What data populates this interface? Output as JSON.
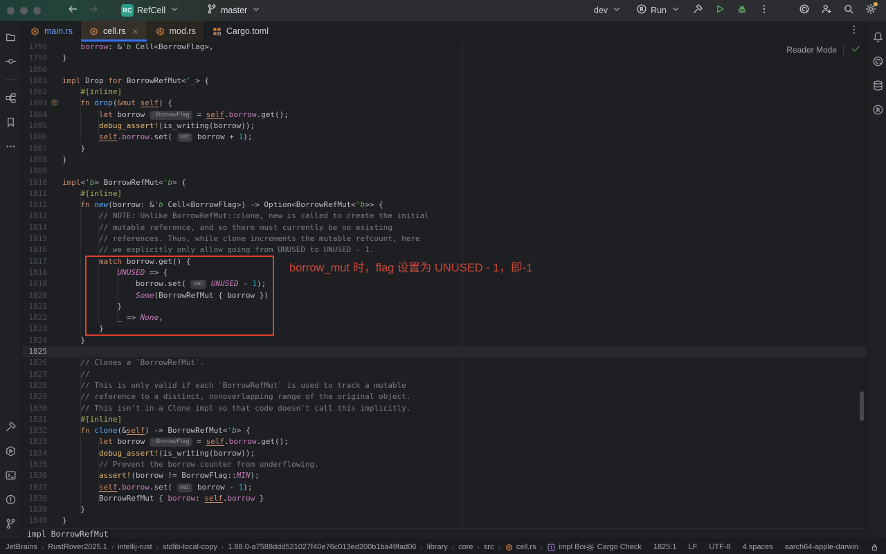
{
  "toolbar": {
    "project_badge": "RC",
    "project_name": "RefCell",
    "branch_name": "master",
    "run_target": "dev",
    "run_label": "Run",
    "left_icons": [
      "back-icon",
      "forward-icon"
    ],
    "right_icons": [
      "build-hammer-icon",
      "run-play-icon",
      "debug-bug-icon",
      "more-kebab-icon",
      "ai-assistant-icon",
      "add-user-icon",
      "search-everywhere-icon",
      "settings-gear-icon"
    ]
  },
  "tabs": [
    {
      "label": "main.rs",
      "icon": "rust-file",
      "active": false,
      "closable": false,
      "tint": false,
      "label_class": "lbl-main"
    },
    {
      "label": "cell.rs",
      "icon": "rust-file",
      "active": true,
      "closable": true,
      "tint": true,
      "label_class": ""
    },
    {
      "label": "mod.rs",
      "icon": "rust-file",
      "active": false,
      "closable": false,
      "tint": true,
      "label_class": ""
    },
    {
      "label": "Cargo.toml",
      "icon": "cargo",
      "active": false,
      "closable": false,
      "tint": false,
      "label_class": ""
    }
  ],
  "left_sidebar": {
    "top": [
      "folder",
      "commit",
      "divider",
      "structure",
      "bookmarks",
      "more"
    ],
    "bottom": [
      "build",
      "services",
      "terminal",
      "problems",
      "git-branch"
    ]
  },
  "right_sidebar": {
    "top": [
      "notifications",
      "ai-assistant",
      "database",
      "rust-tool"
    ]
  },
  "editor": {
    "reader_mode_label": "Reader Mode",
    "sticky_footer": "impl BorrowRefMut",
    "annotation": {
      "text": "borrow_mut 时，flag 设置为 UNUSED - 1，即-1",
      "from_line": 1817,
      "to_line": 1823,
      "box_color": "#E0402F",
      "text_color": "#C9483B"
    },
    "caret_line": 1825,
    "lines": [
      {
        "num": 1798,
        "t": [
          [
            "txt",
            "    "
          ],
          [
            "fld",
            "borrow"
          ],
          [
            "txt",
            ": &"
          ],
          [
            "lif",
            "'b "
          ],
          [
            "txt",
            "Cell<BorrowFlag>,"
          ]
        ]
      },
      {
        "num": 1799,
        "t": [
          [
            "txt",
            "}"
          ]
        ]
      },
      {
        "num": 1800,
        "t": []
      },
      {
        "num": 1801,
        "t": [
          [
            "kw",
            "impl"
          ],
          [
            "txt",
            " Drop "
          ],
          [
            "kw",
            "for"
          ],
          [
            "txt",
            " BorrowRefMut<"
          ],
          [
            "lif",
            "'_"
          ],
          [
            "txt",
            "> {"
          ]
        ]
      },
      {
        "num": 1802,
        "t": [
          [
            "txt",
            "    "
          ],
          [
            "attr",
            "#[inline]"
          ]
        ]
      },
      {
        "num": 1803,
        "icon": "override",
        "t": [
          [
            "txt",
            "    "
          ],
          [
            "kw",
            "fn "
          ],
          [
            "fn",
            "drop"
          ],
          [
            "txt",
            "("
          ],
          [
            "kw",
            "&mut "
          ],
          [
            "slf",
            "self"
          ],
          [
            "txt",
            ") {"
          ]
        ]
      },
      {
        "num": 1804,
        "t": [
          [
            "txt",
            "        "
          ],
          [
            "kw",
            "let"
          ],
          [
            "txt",
            " borrow "
          ],
          [
            "inl",
            ": BorrowFlag"
          ],
          [
            "txt",
            " = "
          ],
          [
            "slf",
            "self"
          ],
          [
            "txt",
            "."
          ],
          [
            "fld",
            "borrow"
          ],
          [
            "txt",
            ".get();"
          ]
        ]
      },
      {
        "num": 1805,
        "t": [
          [
            "txt",
            "        "
          ],
          [
            "mac",
            "debug_assert!"
          ],
          [
            "txt",
            "(is_writing(borrow));"
          ]
        ]
      },
      {
        "num": 1806,
        "t": [
          [
            "txt",
            "        "
          ],
          [
            "slf",
            "self"
          ],
          [
            "txt",
            "."
          ],
          [
            "fld",
            "borrow"
          ],
          [
            "txt",
            ".set( "
          ],
          [
            "inl",
            "val:"
          ],
          [
            "txt",
            " borrow + "
          ],
          [
            "num",
            "1"
          ],
          [
            "txt",
            ");"
          ]
        ]
      },
      {
        "num": 1807,
        "t": [
          [
            "txt",
            "    }"
          ]
        ]
      },
      {
        "num": 1808,
        "t": [
          [
            "txt",
            "}"
          ]
        ]
      },
      {
        "num": 1809,
        "t": []
      },
      {
        "num": 1810,
        "t": [
          [
            "kw",
            "impl"
          ],
          [
            "txt",
            "<"
          ],
          [
            "lif",
            "'b"
          ],
          [
            "txt",
            "> BorrowRefMut<"
          ],
          [
            "lif",
            "'b"
          ],
          [
            "txt",
            "> {"
          ]
        ]
      },
      {
        "num": 1811,
        "t": [
          [
            "txt",
            "    "
          ],
          [
            "attr",
            "#[inline]"
          ]
        ]
      },
      {
        "num": 1812,
        "t": [
          [
            "txt",
            "    "
          ],
          [
            "kw",
            "fn "
          ],
          [
            "fni",
            "new"
          ],
          [
            "txt",
            "(borrow: &"
          ],
          [
            "lif",
            "'b "
          ],
          [
            "txt",
            "Cell<BorrowFlag>) -> Option<BorrowRefMut<"
          ],
          [
            "lif",
            "'b"
          ],
          [
            "txt",
            ">> {"
          ]
        ]
      },
      {
        "num": 1813,
        "t": [
          [
            "txt",
            "        "
          ],
          [
            "cm",
            "// NOTE: Unlike BorrowRefMut::clone, new is called to create the initial"
          ]
        ]
      },
      {
        "num": 1814,
        "t": [
          [
            "txt",
            "        "
          ],
          [
            "cm",
            "// mutable reference, and so there must currently be no existing"
          ]
        ]
      },
      {
        "num": 1815,
        "t": [
          [
            "txt",
            "        "
          ],
          [
            "cm",
            "// references. Thus, while clone increments the mutable refcount, here"
          ]
        ]
      },
      {
        "num": 1816,
        "t": [
          [
            "txt",
            "        "
          ],
          [
            "cm",
            "// we explicitly only allow going from UNUSED to UNUSED - 1."
          ]
        ]
      },
      {
        "num": 1817,
        "t": [
          [
            "txt",
            "        "
          ],
          [
            "kw",
            "match"
          ],
          [
            "txt",
            " borrow.get() {"
          ]
        ]
      },
      {
        "num": 1818,
        "t": [
          [
            "txt",
            "            "
          ],
          [
            "con",
            "UNUSED"
          ],
          [
            "txt",
            " => {"
          ]
        ]
      },
      {
        "num": 1819,
        "t": [
          [
            "txt",
            "                borrow.set( "
          ],
          [
            "inl",
            "val:"
          ],
          [
            "txt",
            " "
          ],
          [
            "con",
            "UNUSED"
          ],
          [
            "txt",
            " - "
          ],
          [
            "num",
            "1"
          ],
          [
            "txt",
            ");"
          ]
        ]
      },
      {
        "num": 1820,
        "t": [
          [
            "txt",
            "                "
          ],
          [
            "con",
            "Some"
          ],
          [
            "txt",
            "(BorrowRefMut { borrow })"
          ]
        ]
      },
      {
        "num": 1821,
        "t": [
          [
            "txt",
            "            }"
          ]
        ]
      },
      {
        "num": 1822,
        "t": [
          [
            "txt",
            "            _ => "
          ],
          [
            "con",
            "None"
          ],
          [
            "txt",
            ","
          ]
        ]
      },
      {
        "num": 1823,
        "t": [
          [
            "txt",
            "        }"
          ]
        ]
      },
      {
        "num": 1824,
        "t": [
          [
            "txt",
            "    }"
          ]
        ]
      },
      {
        "num": 1825,
        "caret": true,
        "t": []
      },
      {
        "num": 1826,
        "t": [
          [
            "txt",
            "    "
          ],
          [
            "cm",
            "// Clones a `BorrowRefMut`."
          ]
        ]
      },
      {
        "num": 1827,
        "t": [
          [
            "txt",
            "    "
          ],
          [
            "cm",
            "//"
          ]
        ]
      },
      {
        "num": 1828,
        "t": [
          [
            "txt",
            "    "
          ],
          [
            "cm",
            "// This is only valid if each `BorrowRefMut` is used to track a mutable"
          ]
        ]
      },
      {
        "num": 1829,
        "t": [
          [
            "txt",
            "    "
          ],
          [
            "cm",
            "// reference to a distinct, nonoverlapping range of the original object."
          ]
        ]
      },
      {
        "num": 1830,
        "t": [
          [
            "txt",
            "    "
          ],
          [
            "cm",
            "// This isn't in a Clone impl so that code doesn't call this implicitly."
          ]
        ]
      },
      {
        "num": 1831,
        "t": [
          [
            "txt",
            "    "
          ],
          [
            "attr",
            "#[inline]"
          ]
        ]
      },
      {
        "num": 1832,
        "t": [
          [
            "txt",
            "    "
          ],
          [
            "kw",
            "fn "
          ],
          [
            "fn",
            "clone"
          ],
          [
            "txt",
            "(&"
          ],
          [
            "slf",
            "self"
          ],
          [
            "txt",
            ") -> BorrowRefMut<"
          ],
          [
            "lif",
            "'b"
          ],
          [
            "txt",
            "> {"
          ]
        ]
      },
      {
        "num": 1833,
        "t": [
          [
            "txt",
            "        "
          ],
          [
            "kw",
            "let"
          ],
          [
            "txt",
            " borrow "
          ],
          [
            "inl",
            ": BorrowFlag"
          ],
          [
            "txt",
            " = "
          ],
          [
            "slf",
            "self"
          ],
          [
            "txt",
            "."
          ],
          [
            "fld",
            "borrow"
          ],
          [
            "txt",
            ".get();"
          ]
        ]
      },
      {
        "num": 1834,
        "t": [
          [
            "txt",
            "        "
          ],
          [
            "mac",
            "debug_assert!"
          ],
          [
            "txt",
            "(is_writing(borrow));"
          ]
        ]
      },
      {
        "num": 1835,
        "t": [
          [
            "txt",
            "        "
          ],
          [
            "cm",
            "// Prevent the borrow counter from underflowing."
          ]
        ]
      },
      {
        "num": 1836,
        "t": [
          [
            "txt",
            "        "
          ],
          [
            "mac",
            "assert!"
          ],
          [
            "txt",
            "(borrow != BorrowFlag::"
          ],
          [
            "con",
            "MIN"
          ],
          [
            "txt",
            ");"
          ]
        ]
      },
      {
        "num": 1837,
        "t": [
          [
            "txt",
            "        "
          ],
          [
            "slf",
            "self"
          ],
          [
            "txt",
            "."
          ],
          [
            "fld",
            "borrow"
          ],
          [
            "txt",
            ".set( "
          ],
          [
            "inl",
            "val:"
          ],
          [
            "txt",
            " borrow - "
          ],
          [
            "num",
            "1"
          ],
          [
            "txt",
            ");"
          ]
        ]
      },
      {
        "num": 1838,
        "t": [
          [
            "txt",
            "        BorrowRefMut { "
          ],
          [
            "fld",
            "borrow"
          ],
          [
            "txt",
            ": "
          ],
          [
            "slf",
            "self"
          ],
          [
            "txt",
            "."
          ],
          [
            "fld",
            "borrow"
          ],
          [
            "txt",
            " }"
          ]
        ]
      },
      {
        "num": 1839,
        "t": [
          [
            "txt",
            "    }"
          ]
        ]
      },
      {
        "num": 1840,
        "t": [
          [
            "txt",
            "}"
          ]
        ]
      }
    ]
  },
  "statusbar": {
    "breadcrumbs": [
      {
        "label": "JetBrains"
      },
      {
        "label": "RustRover2025.1"
      },
      {
        "label": "intellij-rust"
      },
      {
        "label": "stdlib-local-copy"
      },
      {
        "label": "1.88.0-a7588ddd521027f40e76c013ed200b1ba49fad06"
      },
      {
        "label": "library"
      },
      {
        "label": "core"
      },
      {
        "label": "src"
      },
      {
        "label": "cell.rs",
        "icon": "rust-file"
      },
      {
        "label": "impl BorrowRefMut",
        "icon": "impl"
      }
    ],
    "right_items": [
      {
        "label": "Cargo Check",
        "icon": "gear-small"
      },
      {
        "label": "1825:1"
      },
      {
        "label": "LF"
      },
      {
        "label": "UTF-8"
      },
      {
        "label": "4 spaces"
      },
      {
        "label": "aarch64-apple-darwin"
      },
      {
        "label": "",
        "icon": "lock"
      }
    ]
  },
  "colors": {
    "accent_blue": "#3574F0",
    "annotation_red": "#E0402F",
    "run_green": "#5FAD65",
    "project_badge_teal": "#2E9E8B"
  }
}
